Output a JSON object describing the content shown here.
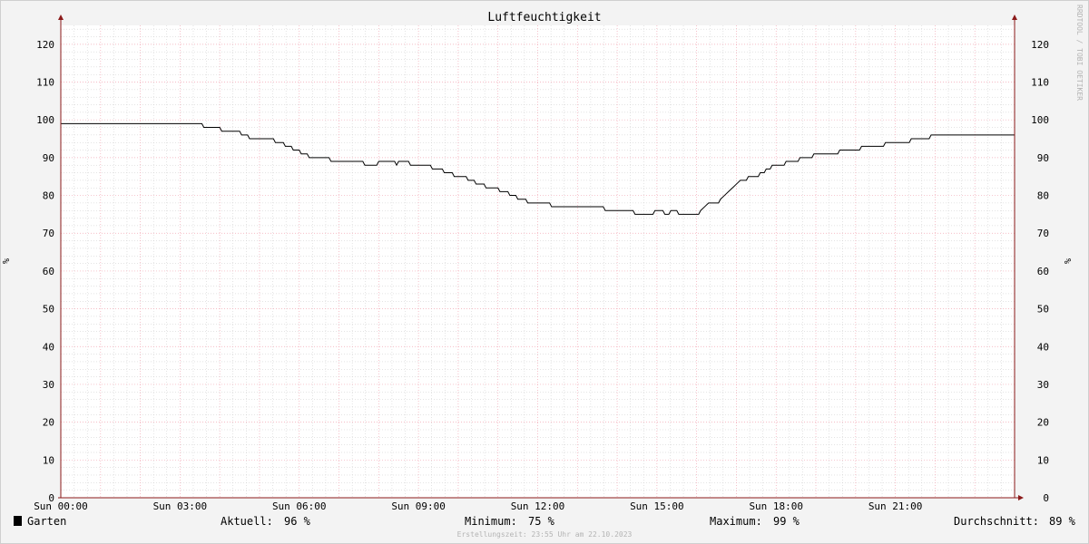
{
  "chart_data": {
    "type": "line",
    "title": "Luftfeuchtigkeit",
    "ylabel": "%",
    "y2label": "%",
    "watermark": "RRDTOOL / TOBI OETIKER",
    "ylim": [
      0,
      125
    ],
    "yticks": [
      0,
      10,
      20,
      30,
      40,
      50,
      60,
      70,
      80,
      90,
      100,
      110,
      120
    ],
    "xlim": [
      0,
      24
    ],
    "xticks": [
      {
        "t": 0,
        "label": "Sun 00:00"
      },
      {
        "t": 3,
        "label": "Sun 03:00"
      },
      {
        "t": 6,
        "label": "Sun 06:00"
      },
      {
        "t": 9,
        "label": "Sun 09:00"
      },
      {
        "t": 12,
        "label": "Sun 12:00"
      },
      {
        "t": 15,
        "label": "Sun 15:00"
      },
      {
        "t": 18,
        "label": "Sun 18:00"
      },
      {
        "t": 21,
        "label": "Sun 21:00"
      }
    ],
    "grid": true,
    "colors": {
      "line": "#000000",
      "major_grid": "#f2a7b4",
      "minor_grid": "#c9c9c9",
      "axis": "#8b1a1a",
      "background": "#f3f3f3",
      "plot": "#ffffff"
    },
    "series": [
      {
        "name": "Garten",
        "points": [
          [
            0,
            99
          ],
          [
            3.55,
            99
          ],
          [
            3.6,
            98
          ],
          [
            4.0,
            98
          ],
          [
            4.05,
            97
          ],
          [
            4.5,
            97
          ],
          [
            4.55,
            96
          ],
          [
            4.7,
            96
          ],
          [
            4.75,
            95
          ],
          [
            5.35,
            95
          ],
          [
            5.4,
            94
          ],
          [
            5.6,
            94
          ],
          [
            5.65,
            93
          ],
          [
            5.8,
            93
          ],
          [
            5.85,
            92
          ],
          [
            6.0,
            92
          ],
          [
            6.05,
            91
          ],
          [
            6.2,
            91
          ],
          [
            6.25,
            90
          ],
          [
            6.75,
            90
          ],
          [
            6.8,
            89
          ],
          [
            7.6,
            89
          ],
          [
            7.65,
            88
          ],
          [
            7.95,
            88
          ],
          [
            8.0,
            89
          ],
          [
            8.4,
            89
          ],
          [
            8.45,
            88
          ],
          [
            8.5,
            89
          ],
          [
            8.75,
            89
          ],
          [
            8.8,
            88
          ],
          [
            9.3,
            88
          ],
          [
            9.35,
            87
          ],
          [
            9.6,
            87
          ],
          [
            9.65,
            86
          ],
          [
            9.85,
            86
          ],
          [
            9.9,
            85
          ],
          [
            10.2,
            85
          ],
          [
            10.25,
            84
          ],
          [
            10.4,
            84
          ],
          [
            10.45,
            83
          ],
          [
            10.65,
            83
          ],
          [
            10.7,
            82
          ],
          [
            11.0,
            82
          ],
          [
            11.05,
            81
          ],
          [
            11.25,
            81
          ],
          [
            11.3,
            80
          ],
          [
            11.45,
            80
          ],
          [
            11.5,
            79
          ],
          [
            11.7,
            79
          ],
          [
            11.75,
            78
          ],
          [
            12.3,
            78
          ],
          [
            12.35,
            77
          ],
          [
            13.65,
            77
          ],
          [
            13.7,
            76
          ],
          [
            14.4,
            76
          ],
          [
            14.45,
            75
          ],
          [
            14.9,
            75
          ],
          [
            14.95,
            76
          ],
          [
            15.15,
            76
          ],
          [
            15.2,
            75
          ],
          [
            15.3,
            75
          ],
          [
            15.35,
            76
          ],
          [
            15.5,
            76
          ],
          [
            15.55,
            75
          ],
          [
            16.05,
            75
          ],
          [
            16.1,
            76
          ],
          [
            16.2,
            77
          ],
          [
            16.3,
            78
          ],
          [
            16.55,
            78
          ],
          [
            16.6,
            79
          ],
          [
            16.7,
            80
          ],
          [
            16.8,
            81
          ],
          [
            16.9,
            82
          ],
          [
            17.0,
            83
          ],
          [
            17.1,
            84
          ],
          [
            17.25,
            84
          ],
          [
            17.3,
            85
          ],
          [
            17.55,
            85
          ],
          [
            17.6,
            86
          ],
          [
            17.7,
            86
          ],
          [
            17.75,
            87
          ],
          [
            17.85,
            87
          ],
          [
            17.9,
            88
          ],
          [
            18.2,
            88
          ],
          [
            18.25,
            89
          ],
          [
            18.55,
            89
          ],
          [
            18.6,
            90
          ],
          [
            18.9,
            90
          ],
          [
            18.95,
            91
          ],
          [
            19.55,
            91
          ],
          [
            19.6,
            92
          ],
          [
            20.1,
            92
          ],
          [
            20.15,
            93
          ],
          [
            20.7,
            93
          ],
          [
            20.75,
            94
          ],
          [
            21.35,
            94
          ],
          [
            21.4,
            95
          ],
          [
            21.85,
            95
          ],
          [
            21.9,
            96
          ],
          [
            24,
            96
          ]
        ]
      }
    ]
  },
  "legend": {
    "series_name": "Garten",
    "swatch_color": "#000000",
    "current_label": "Aktuell:",
    "current_value": "96 %",
    "minimum_label": "Minimum:",
    "minimum_value": "75 %",
    "maximum_label": "Maximum:",
    "maximum_value": "99 %",
    "average_label": "Durchschnitt:",
    "average_value": "89 %"
  },
  "footer": "Erstellungszeit: 23:55 Uhr am 22.10.2023"
}
